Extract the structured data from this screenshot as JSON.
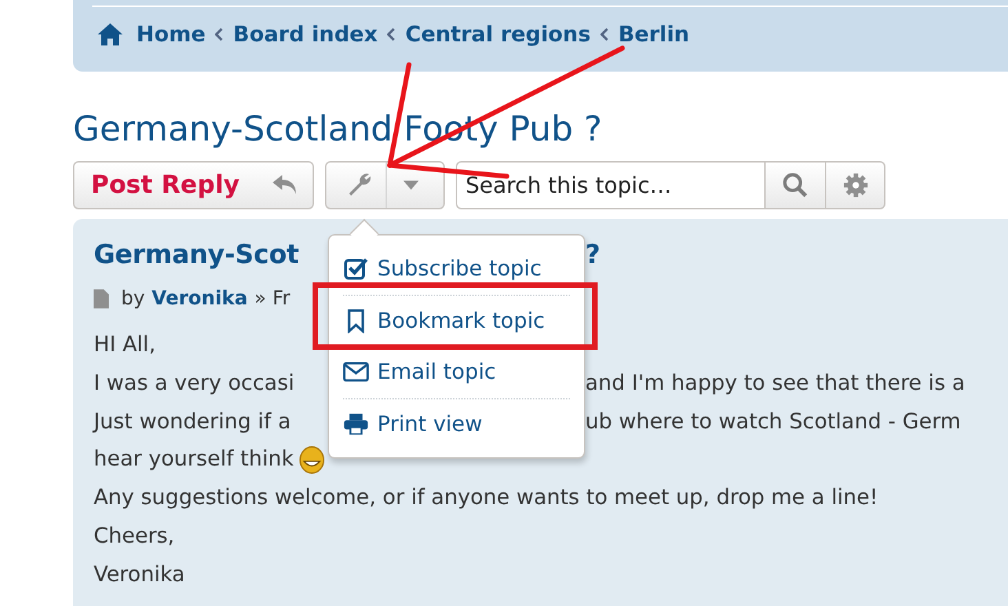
{
  "breadcrumbs": [
    {
      "label": "Home"
    },
    {
      "label": "Board index"
    },
    {
      "label": "Central regions"
    },
    {
      "label": "Berlin"
    }
  ],
  "topic_title": "Germany-Scotland Footy Pub ?",
  "toolbar": {
    "post_reply": "Post Reply",
    "search": {
      "placeholder": "Search this topic…"
    }
  },
  "tools_menu": {
    "expanded": true,
    "items": [
      {
        "label": "Subscribe topic"
      },
      {
        "label": "Bookmark topic"
      },
      {
        "label": "Email topic"
      },
      {
        "label": "Print view"
      }
    ]
  },
  "post": {
    "title_parts": [
      "Germany-Scot",
      "?"
    ],
    "byline": {
      "by": "by",
      "author": "Veronika",
      "rest": "» Fr"
    },
    "lines": [
      {
        "parts": [
          "HI All,"
        ]
      },
      {
        "parts": [
          "I was a very occasi",
          "and I'm happy to see that there is a"
        ]
      },
      {
        "parts": [
          "Just wondering if a",
          "ub where to watch Scotland - Germ"
        ]
      },
      {
        "parts": [
          "hear yourself think"
        ],
        "emoji": true
      },
      {
        "parts": [
          "Any suggestions welcome, or if anyone wants to meet up, drop me a line!"
        ]
      },
      {
        "parts": [
          "Cheers,"
        ]
      },
      {
        "parts": [
          "Veronika"
        ]
      }
    ]
  }
}
